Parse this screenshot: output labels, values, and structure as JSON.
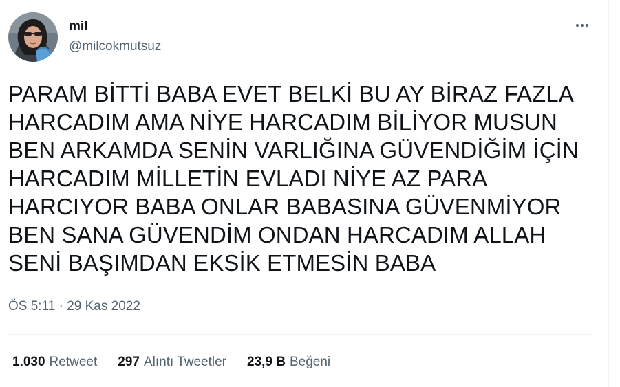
{
  "user": {
    "display_name": "mil",
    "handle": "@milcokmutsuz",
    "avatar_icon": "profile-photo"
  },
  "tweet": {
    "text": "PARAM BİTTİ BABA EVET BELKİ BU AY BİRAZ FAZLA\nHARCADIM AMA NİYE HARCADIM BİLİYOR MUSUN\nBEN ARKAMDA SENİN VARLIĞINA GÜVENDİĞİM İÇİN\nHARCADIM MİLLETİN EVLADI NİYE AZ PARA\nHARCIYOR BABA ONLAR BABASINA GÜVENMİYOR\nBEN SANA GÜVENDİM ONDAN HARCADIM ALLAH\nSENİ BAŞIMDAN EKSİK ETMESİN BABA",
    "time": "ÖS 5:11",
    "separator": "·",
    "date": "29 Kas 2022"
  },
  "stats": {
    "retweets_count": "1.030",
    "retweets_label": "Retweet",
    "quotes_count": "297",
    "quotes_label": "Alıntı Tweetler",
    "likes_count": "23,9 B",
    "likes_label": "Beğeni"
  },
  "more_icon": "more-horizontal-icon",
  "colors": {
    "primary_text": "#0f1419",
    "secondary_text": "#536471",
    "divider": "#eff3f4"
  }
}
